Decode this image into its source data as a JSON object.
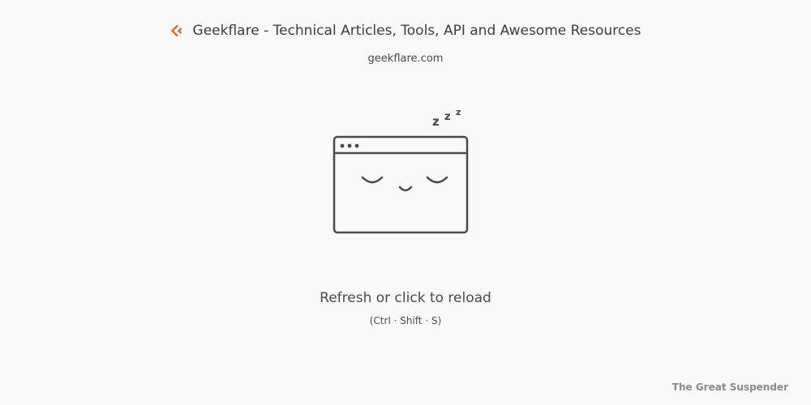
{
  "tab": {
    "title": "Geekflare - Technical Articles, Tools, API and Awesome Resources",
    "url": "geekflare.com",
    "favicon_icon": "geekflare-logo-icon",
    "favicon_color": "#e8692c"
  },
  "suspended": {
    "illustration_icon": "sleeping-browser-window-icon",
    "snore_text": "zzz",
    "reload_label": "Refresh or click to reload",
    "shortcut_hint": "(Ctrl · Shift · S)"
  },
  "footer": {
    "brand_label": "The Great Suspender"
  }
}
